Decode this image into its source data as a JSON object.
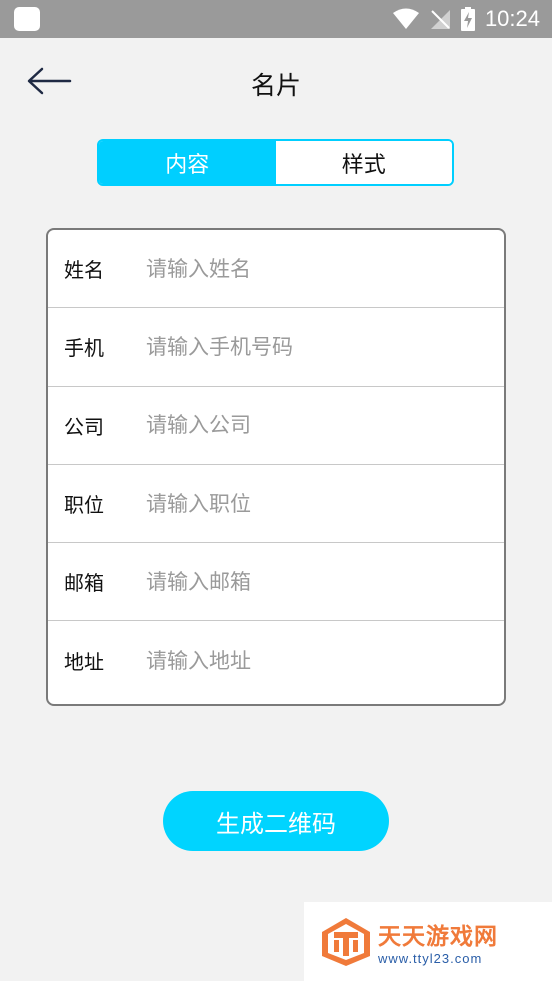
{
  "status_bar": {
    "time": "10:24",
    "icons": [
      "app-icon",
      "wifi-icon",
      "no-signal-icon",
      "battery-charging-icon"
    ]
  },
  "header": {
    "title": "名片",
    "back_icon": "arrow-left-icon"
  },
  "tabs": [
    {
      "label": "内容",
      "active": true
    },
    {
      "label": "样式",
      "active": false
    }
  ],
  "form": {
    "fields": [
      {
        "label": "姓名",
        "placeholder": "请输入姓名",
        "value": ""
      },
      {
        "label": "手机",
        "placeholder": "请输入手机号码",
        "value": ""
      },
      {
        "label": "公司",
        "placeholder": "请输入公司",
        "value": ""
      },
      {
        "label": "职位",
        "placeholder": "请输入职位",
        "value": ""
      },
      {
        "label": "邮箱",
        "placeholder": "请输入邮箱",
        "value": ""
      },
      {
        "label": "地址",
        "placeholder": "请输入地址",
        "value": ""
      }
    ]
  },
  "actions": {
    "generate_label": "生成二维码"
  },
  "watermark": {
    "title": "天天游戏网",
    "url": "www.ttyl23.com"
  },
  "colors": {
    "accent": "#00cfff",
    "status_bar": "#9a9a9a",
    "background": "#f2f2f2",
    "watermark_orange": "#f07a3a",
    "watermark_blue": "#2a5ea8"
  }
}
